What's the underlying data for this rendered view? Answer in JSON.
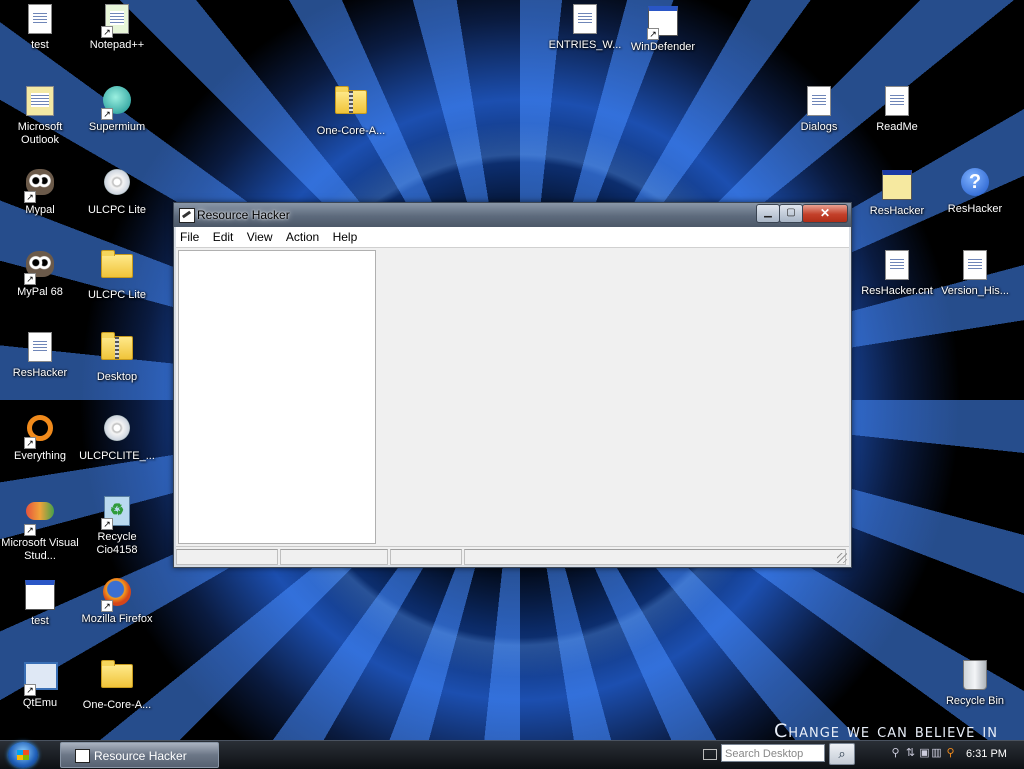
{
  "desktop": {
    "icons": [
      {
        "label": "test"
      },
      {
        "label": "Notepad++"
      },
      {
        "label": "ENTRIES_W..."
      },
      {
        "label": "WinDefender"
      },
      {
        "label": "Microsoft Outlook"
      },
      {
        "label": "Supermium"
      },
      {
        "label": "One-Core-A..."
      },
      {
        "label": "Dialogs"
      },
      {
        "label": "ReadMe"
      },
      {
        "label": "Mypal"
      },
      {
        "label": "ULCPC Lite"
      },
      {
        "label": "ResHacker"
      },
      {
        "label": "ResHacker"
      },
      {
        "label": "MyPal 68"
      },
      {
        "label": "ULCPC Lite"
      },
      {
        "label": "ResHacker.cnt"
      },
      {
        "label": "Version_His..."
      },
      {
        "label": "ResHacker"
      },
      {
        "label": "Desktop"
      },
      {
        "label": "Everything"
      },
      {
        "label": "ULCPCLITE_..."
      },
      {
        "label": "Microsoft Visual Stud..."
      },
      {
        "label": "Recycle Cio4158"
      },
      {
        "label": "test"
      },
      {
        "label": "Mozilla Firefox"
      },
      {
        "label": "QtEmu"
      },
      {
        "label": "One-Core-A..."
      },
      {
        "label": "Recycle Bin"
      }
    ],
    "slogan": "Change we can believe in"
  },
  "window": {
    "title": "Resource Hacker",
    "menu": [
      "File",
      "Edit",
      "View",
      "Action",
      "Help"
    ],
    "caption_buttons": {
      "minimize": "▁",
      "maximize": "▢",
      "close": "✕"
    }
  },
  "taskbar": {
    "task_label": "Resource Hacker",
    "search_placeholder": "Search Desktop",
    "search_button_icon": "magnifier-icon",
    "clock": "6:31 PM"
  },
  "colors": {
    "accent_blue": "#1c4fb0",
    "close_red": "#c3402a"
  }
}
